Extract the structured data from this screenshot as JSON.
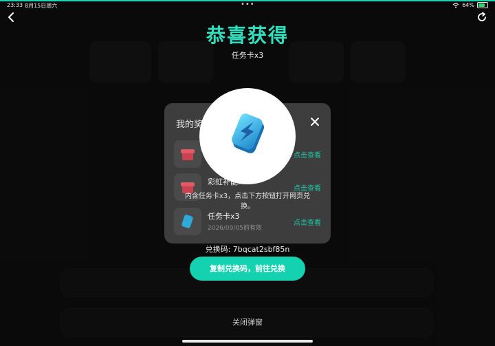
{
  "status_bar": {
    "time": "23:33",
    "date": "8月15日周六",
    "battery": "64%",
    "battery_level": 0.64,
    "accent": "#1ed4b0"
  },
  "nav": {
    "back_icon": "chevron-left-icon",
    "refresh_icon": "refresh-icon"
  },
  "reward": {
    "title": "恭喜获得",
    "subtitle": "任务卡x3",
    "description": "内含任务卡x3，点击下方按钮打开网页兑换。",
    "code_label": "兑换码: 7bqcat2sbf85n",
    "copy_button": "复制兑换码，前往兑换",
    "close_label": "关闭弹窗",
    "accent": "#2fe0bf"
  },
  "rewards_panel": {
    "title_visible": "我的奖",
    "close_icon": "close-icon",
    "items": [
      {
        "name": "",
        "date": "",
        "link": "点击查看"
      },
      {
        "name": "彩虹补能...",
        "date": "",
        "link": "点击查看"
      },
      {
        "name": "任务卡x3",
        "date": "2026/09/05前有效",
        "link": "点击查看"
      }
    ]
  }
}
